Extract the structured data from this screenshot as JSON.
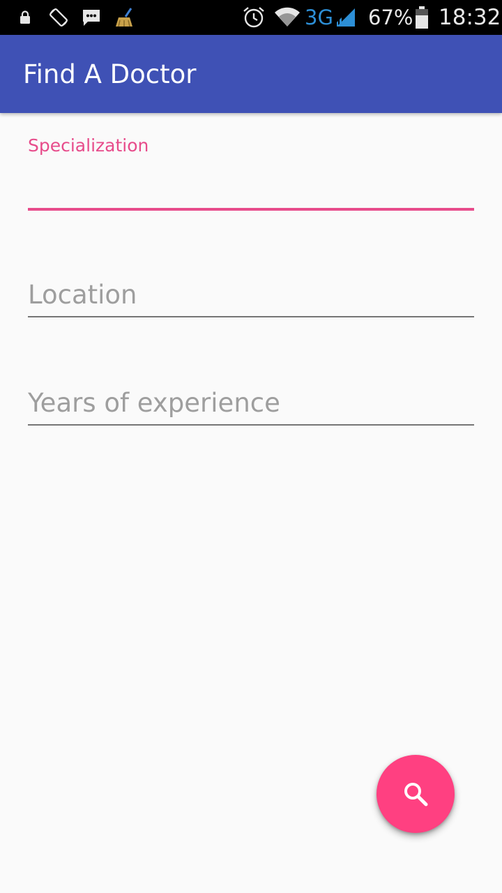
{
  "status_bar": {
    "icons": [
      "lock-icon",
      "screen-rotation-icon",
      "message-icon",
      "cleaner-icon",
      "alarm-icon",
      "wifi-icon",
      "signal-icon",
      "battery-icon"
    ],
    "network": "3G",
    "battery": "67%",
    "time": "18:32"
  },
  "app_bar": {
    "title": "Find A Doctor"
  },
  "form": {
    "specialization": {
      "label": "Specialization",
      "value": ""
    },
    "location": {
      "placeholder": "Location",
      "value": ""
    },
    "experience": {
      "placeholder": "Years of experience",
      "value": ""
    }
  },
  "fab": {
    "icon": "search-icon"
  },
  "colors": {
    "primary": "#3f51b5",
    "accent": "#ff4081",
    "label_accent": "#e74c8b",
    "hint": "#9e9e9e",
    "background": "#fafafa"
  }
}
